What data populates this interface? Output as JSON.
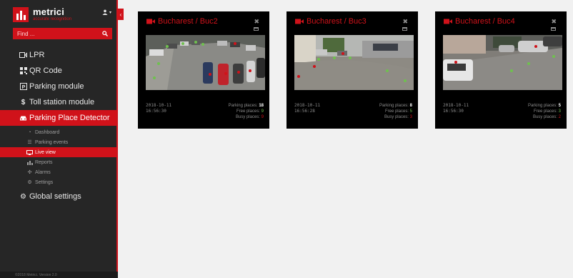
{
  "brand": {
    "name": "metrici",
    "tagline": "accurate recognition"
  },
  "search": {
    "placeholder": "Find ..."
  },
  "nav": {
    "lpr": "LPR",
    "qr": "QR Code",
    "parking": "Parking module",
    "toll": "Toll station module",
    "detector": "Parking Place Detector",
    "global": "Global settings"
  },
  "sub": {
    "dashboard": "Dashboard",
    "events": "Parking events",
    "live": "Live view",
    "reports": "Reports",
    "alarms": "Alarms",
    "settings": "Settings"
  },
  "footer": "©2018 Metrici. Version 2.0",
  "labels": {
    "parking": "Parking places:",
    "free": "Free places:",
    "busy": "Busy places:"
  },
  "colors": {
    "accent": "#d0121a",
    "sidebar": "#262626",
    "free": "#6fc04f"
  },
  "cameras": [
    {
      "title": "Bucharest / Buc2",
      "date": "2018-10-11",
      "time": "16:56:30",
      "parking": "18",
      "free": "9",
      "busy": "9"
    },
    {
      "title": "Bucharest / Buc3",
      "date": "2018-10-11",
      "time": "16:56:28",
      "parking": "8",
      "free": "5",
      "busy": "3"
    },
    {
      "title": "Bucharest / Buc4",
      "date": "2018-10-11",
      "time": "16:56:30",
      "parking": "5",
      "free": "3",
      "busy": "2"
    }
  ]
}
